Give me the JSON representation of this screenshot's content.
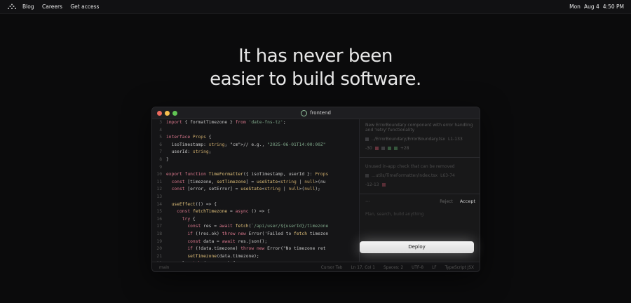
{
  "menubar": {
    "nav": [
      "Blog",
      "Careers",
      "Get access"
    ],
    "day": "Mon",
    "date": "Aug 4",
    "time": "4:50 PM"
  },
  "hero": {
    "line1": "It has never been",
    "line2": "easier to build software."
  },
  "window": {
    "title": "frontend"
  },
  "editor": {
    "lines": [
      {
        "n": "3",
        "t": "import { formatTimezone } from 'date-fns-tz';"
      },
      {
        "n": "4",
        "t": ""
      },
      {
        "n": "5",
        "t": "interface Props {"
      },
      {
        "n": "6",
        "t": "  isoTimestamp: string; // e.g., \"2025-06-01T14:00:00Z\""
      },
      {
        "n": "7",
        "t": "  userId: string;"
      },
      {
        "n": "8",
        "t": "}"
      },
      {
        "n": "9",
        "t": ""
      },
      {
        "n": "10",
        "t": "export function TimeFormatter({ isoTimestamp, userId }: Props"
      },
      {
        "n": "11",
        "t": "  const [timezone, setTimezone] = useState<string | null>(nu"
      },
      {
        "n": "12",
        "t": "  const [error, setError] = useState<string | null>(null);"
      },
      {
        "n": "13",
        "t": ""
      },
      {
        "n": "14",
        "t": "  useEffect(() => {"
      },
      {
        "n": "15",
        "t": "    const fetchTimezone = async () => {"
      },
      {
        "n": "16",
        "t": "      try {"
      },
      {
        "n": "17",
        "t": "        const res = await fetch(`/api/user/${userId}/timezone"
      },
      {
        "n": "18",
        "t": "        if (!res.ok) throw new Error('Failed to fetch timezon"
      },
      {
        "n": "19",
        "t": "        const data = await res.json();"
      },
      {
        "n": "20",
        "t": "        if (!data.timezone) throw new Error(\"No timezone ret"
      },
      {
        "n": "21",
        "t": "        setTimezone(data.timezone);"
      },
      {
        "n": "22",
        "t": "      } catch (err: any) {"
      }
    ]
  },
  "panel": {
    "item1_desc": "New ErrorBoundary component with error handling and 'retry' functionality",
    "item1_file": "../ErrorBoundary/ErrorBoundary.tsx",
    "item1_loc": "L1-133",
    "item1_count": "+28",
    "item1_minus": "-30",
    "item2_desc": "Unused in-app check that can be removed",
    "item2_file": "...utils/TimeFormatter/index.tsx",
    "item2_loc": "L63-74",
    "item2_minus": "-12-13",
    "reject": "Reject",
    "accept": "Accept",
    "hint": "Plan, search, build anything",
    "deploy": "Deploy"
  },
  "status": {
    "left": "main",
    "items": [
      "Cursor Tab",
      "Ln 17, Col 1",
      "Spaces: 2",
      "UTF-8",
      "LF",
      "TypeScript JSX"
    ]
  }
}
